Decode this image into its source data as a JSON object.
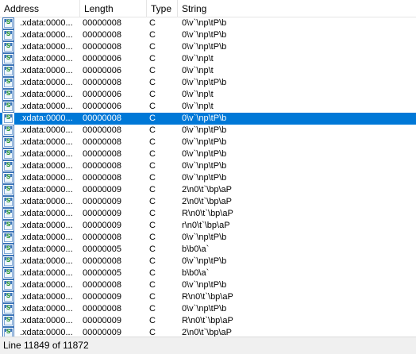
{
  "colors": {
    "selection": "#0078d7",
    "icon_letter": "#1f8f2a",
    "icon_border": "#3c74b8"
  },
  "header": {
    "address": "Address",
    "length": "Length",
    "type": "Type",
    "string": "String"
  },
  "rows": [
    {
      "icon": "string-icon",
      "address": ".xdata:0000...",
      "length": "00000008",
      "type": "C",
      "string": "0\\v`\\np\\tP\\b"
    },
    {
      "icon": "string-icon",
      "address": ".xdata:0000...",
      "length": "00000008",
      "type": "C",
      "string": "0\\v`\\np\\tP\\b"
    },
    {
      "icon": "string-icon",
      "address": ".xdata:0000...",
      "length": "00000008",
      "type": "C",
      "string": "0\\v`\\np\\tP\\b"
    },
    {
      "icon": "string-icon",
      "address": ".xdata:0000...",
      "length": "00000006",
      "type": "C",
      "string": "0\\v`\\np\\t"
    },
    {
      "icon": "string-icon",
      "address": ".xdata:0000...",
      "length": "00000006",
      "type": "C",
      "string": "0\\v`\\np\\t"
    },
    {
      "icon": "string-icon",
      "address": ".xdata:0000...",
      "length": "00000008",
      "type": "C",
      "string": "0\\v`\\np\\tP\\b"
    },
    {
      "icon": "string-icon",
      "address": ".xdata:0000...",
      "length": "00000006",
      "type": "C",
      "string": "0\\v`\\np\\t"
    },
    {
      "icon": "string-icon",
      "address": ".xdata:0000...",
      "length": "00000006",
      "type": "C",
      "string": "0\\v`\\np\\t"
    },
    {
      "icon": "string-icon",
      "address": ".xdata:0000...",
      "length": "00000008",
      "type": "C",
      "string": "0\\v`\\np\\tP\\b",
      "selected": true
    },
    {
      "icon": "string-icon",
      "address": ".xdata:0000...",
      "length": "00000008",
      "type": "C",
      "string": "0\\v`\\np\\tP\\b"
    },
    {
      "icon": "string-icon",
      "address": ".xdata:0000...",
      "length": "00000008",
      "type": "C",
      "string": "0\\v`\\np\\tP\\b"
    },
    {
      "icon": "string-icon",
      "address": ".xdata:0000...",
      "length": "00000008",
      "type": "C",
      "string": "0\\v`\\np\\tP\\b"
    },
    {
      "icon": "string-icon",
      "address": ".xdata:0000...",
      "length": "00000008",
      "type": "C",
      "string": "0\\v`\\np\\tP\\b"
    },
    {
      "icon": "string-icon",
      "address": ".xdata:0000...",
      "length": "00000008",
      "type": "C",
      "string": "0\\v`\\np\\tP\\b"
    },
    {
      "icon": "string-icon",
      "address": ".xdata:0000...",
      "length": "00000009",
      "type": "C",
      "string": "2\\n0\\t`\\bp\\aP"
    },
    {
      "icon": "string-icon",
      "address": ".xdata:0000...",
      "length": "00000009",
      "type": "C",
      "string": "2\\n0\\t`\\bp\\aP"
    },
    {
      "icon": "string-icon",
      "address": ".xdata:0000...",
      "length": "00000009",
      "type": "C",
      "string": "R\\n0\\t`\\bp\\aP"
    },
    {
      "icon": "string-icon",
      "address": ".xdata:0000...",
      "length": "00000009",
      "type": "C",
      "string": "r\\n0\\t`\\bp\\aP"
    },
    {
      "icon": "string-icon",
      "address": ".xdata:0000...",
      "length": "00000008",
      "type": "C",
      "string": "0\\v`\\np\\tP\\b"
    },
    {
      "icon": "string-icon",
      "address": ".xdata:0000...",
      "length": "00000005",
      "type": "C",
      "string": "b\\b0\\a`"
    },
    {
      "icon": "string-icon",
      "address": ".xdata:0000...",
      "length": "00000008",
      "type": "C",
      "string": "0\\v`\\np\\tP\\b"
    },
    {
      "icon": "string-icon",
      "address": ".xdata:0000...",
      "length": "00000005",
      "type": "C",
      "string": "b\\b0\\a`"
    },
    {
      "icon": "string-icon",
      "address": ".xdata:0000...",
      "length": "00000008",
      "type": "C",
      "string": "0\\v`\\np\\tP\\b"
    },
    {
      "icon": "string-icon",
      "address": ".xdata:0000...",
      "length": "00000009",
      "type": "C",
      "string": "R\\n0\\t`\\bp\\aP"
    },
    {
      "icon": "string-icon",
      "address": ".xdata:0000...",
      "length": "00000008",
      "type": "C",
      "string": "0\\v`\\np\\tP\\b"
    },
    {
      "icon": "string-icon",
      "address": ".xdata:0000...",
      "length": "00000009",
      "type": "C",
      "string": "R\\n0\\t`\\bp\\aP"
    },
    {
      "icon": "string-icon",
      "address": ".xdata:0000...",
      "length": "00000009",
      "type": "C",
      "string": "2\\n0\\t`\\bp\\aP"
    }
  ],
  "status": {
    "text": "Line 11849 of 11872"
  }
}
